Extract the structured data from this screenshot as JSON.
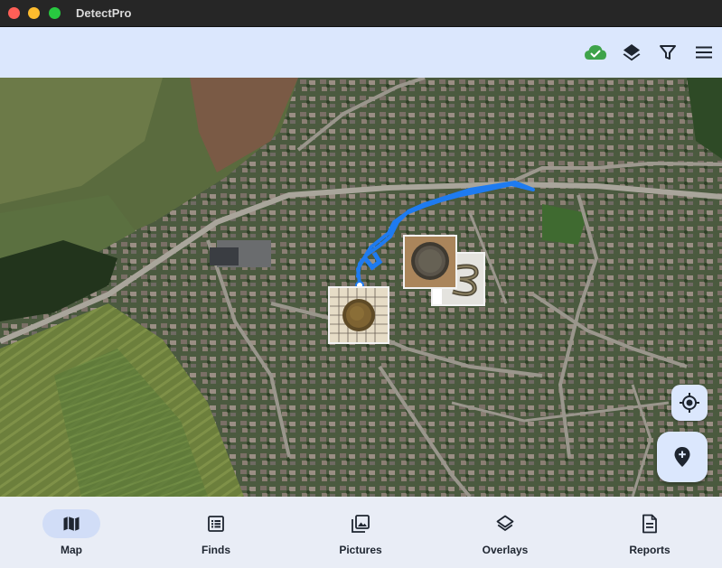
{
  "window": {
    "title": "DetectPro"
  },
  "appbar": {
    "actions": [
      {
        "name": "cloud-sync",
        "icon": "cloud-check-icon",
        "color": "#3ea34a"
      },
      {
        "name": "layers",
        "icon": "layers-icon"
      },
      {
        "name": "filter",
        "icon": "filter-icon"
      },
      {
        "name": "menu",
        "icon": "menu-icon"
      }
    ]
  },
  "map": {
    "view": "satellite",
    "track_color": "#1e7bf0",
    "finds": [
      {
        "name": "find-coin-1",
        "type": "coin photo"
      },
      {
        "name": "find-coin-2",
        "type": "coin photo"
      },
      {
        "name": "find-relic",
        "type": "relic photo"
      }
    ],
    "controls": {
      "my_location_icon": "my-location-icon",
      "add_find_icon": "add-location-icon"
    }
  },
  "nav": {
    "active": "Map",
    "items": [
      {
        "label": "Map",
        "icon": "map-icon"
      },
      {
        "label": "Finds",
        "icon": "list-icon"
      },
      {
        "label": "Pictures",
        "icon": "pictures-icon"
      },
      {
        "label": "Overlays",
        "icon": "layers-icon"
      },
      {
        "label": "Reports",
        "icon": "document-icon"
      }
    ]
  },
  "colors": {
    "appbar_bg": "#dbe7fd",
    "nav_bg": "#e9edf6",
    "nav_active_pill": "#d1ddf7"
  }
}
